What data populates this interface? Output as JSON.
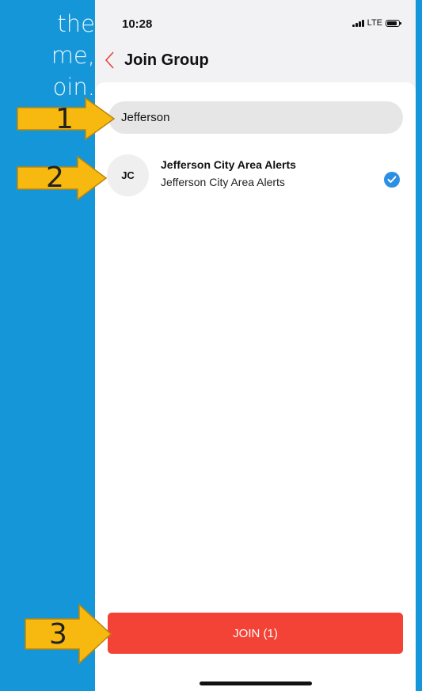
{
  "background_text": {
    "line1": "the",
    "line2": "me,",
    "line3": "oin."
  },
  "status_bar": {
    "time": "10:28",
    "network": "LTE"
  },
  "nav": {
    "title": "Join Group",
    "back_icon": "chevron-left-icon"
  },
  "search": {
    "value": "Jefferson"
  },
  "results": [
    {
      "initials": "JC",
      "title": "Jefferson City Area Alerts",
      "subtitle": "Jefferson City Area Alerts",
      "selected": true
    }
  ],
  "join_button": {
    "label": "JOIN (1)"
  },
  "annotations": [
    {
      "number": "1",
      "icon": "arrow-right-icon"
    },
    {
      "number": "2",
      "icon": "arrow-right-icon"
    },
    {
      "number": "3",
      "icon": "arrow-right-icon"
    }
  ],
  "colors": {
    "background": "#1596d8",
    "accent_red": "#f34336",
    "check_blue": "#2d8fe3",
    "arrow_fill": "#f7b90f"
  }
}
